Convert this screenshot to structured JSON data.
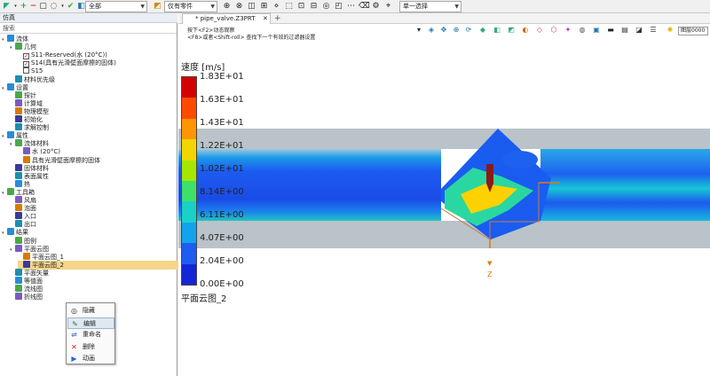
{
  "toolbar": {
    "filter_select": "全部",
    "scope_select": "仅有零件",
    "mode_select": "单一选择"
  },
  "left_panel": {
    "title": "仿真",
    "search_placeholder": "搜索",
    "tree": [
      {
        "label": "流体",
        "level": 0,
        "icon": "fluid-icon",
        "toggle": "▾"
      },
      {
        "label": "几何",
        "level": 1,
        "icon": "geometry-icon",
        "toggle": "▾"
      },
      {
        "label": "S11-Reserved(水 (20°C))",
        "level": 2,
        "checkbox": true,
        "checked": true
      },
      {
        "label": "S14(具有光滑壁面摩擦的固体)",
        "level": 2,
        "checkbox": true,
        "checked": true
      },
      {
        "label": "S15",
        "level": 2,
        "checkbox": true,
        "checked": false
      },
      {
        "label": "材料优先级",
        "level": 1,
        "icon": "material-priority-icon"
      },
      {
        "label": "设置",
        "level": 0,
        "icon": "settings-icon",
        "toggle": "▾"
      },
      {
        "label": "探针",
        "level": 1,
        "icon": "probe-icon"
      },
      {
        "label": "计算域",
        "level": 1,
        "icon": "domain-icon"
      },
      {
        "label": "物理模型",
        "level": 1,
        "icon": "physics-icon"
      },
      {
        "label": "初始化",
        "level": 1,
        "icon": "init-icon"
      },
      {
        "label": "求解控制",
        "level": 1,
        "icon": "solver-icon"
      },
      {
        "label": "属性",
        "level": 0,
        "icon": "properties-icon",
        "toggle": "▾"
      },
      {
        "label": "流体材料",
        "level": 1,
        "icon": "fluid-material-icon",
        "toggle": "▾"
      },
      {
        "label": "水 (20°C)",
        "level": 2,
        "icon": "water-icon"
      },
      {
        "label": "具有光滑壁面摩擦的固体",
        "level": 2,
        "icon": "solid-icon"
      },
      {
        "label": "固体材料",
        "level": 1,
        "icon": "solid-material-icon"
      },
      {
        "label": "表面属性",
        "level": 1,
        "icon": "surface-icon"
      },
      {
        "label": "热",
        "level": 1,
        "icon": "heat-icon"
      },
      {
        "label": "工具箱",
        "level": 0,
        "icon": "toolbox-icon",
        "toggle": "▾"
      },
      {
        "label": "风扇",
        "level": 1,
        "icon": "fan-icon"
      },
      {
        "label": "泡面",
        "level": 1,
        "icon": "foam-icon"
      },
      {
        "label": "入口",
        "level": 1,
        "icon": "inlet-icon"
      },
      {
        "label": "出口",
        "level": 1,
        "icon": "outlet-icon"
      },
      {
        "label": "结果",
        "level": 0,
        "icon": "results-icon",
        "toggle": "▾"
      },
      {
        "label": "图例",
        "level": 1,
        "icon": "legend-icon"
      },
      {
        "label": "平面云图",
        "level": 1,
        "icon": "plane-contour-icon",
        "toggle": "▾"
      },
      {
        "label": "平面云图_1",
        "level": 2,
        "icon": "contour-item-icon"
      },
      {
        "label": "平面云图_2",
        "level": 2,
        "icon": "contour-item-icon",
        "selected": true
      },
      {
        "label": "平面矢量",
        "level": 1,
        "icon": "plane-vector-icon"
      },
      {
        "label": "等值面",
        "level": 1,
        "icon": "isosurface-icon"
      },
      {
        "label": "流线图",
        "level": 1,
        "icon": "streamline-icon"
      },
      {
        "label": "折线图",
        "level": 1,
        "icon": "line-chart-icon"
      }
    ]
  },
  "context_menu": {
    "items": [
      {
        "label": "隐藏",
        "icon": "hide-icon",
        "glyph": "◎"
      },
      {
        "label": "编辑",
        "icon": "edit-icon",
        "glyph": "✎",
        "hover": true
      },
      {
        "label": "重命名",
        "icon": "rename-icon",
        "glyph": "⇌"
      },
      {
        "label": "删除",
        "icon": "delete-icon",
        "glyph": "✕"
      },
      {
        "label": "动画",
        "icon": "animate-icon",
        "glyph": "▶"
      }
    ]
  },
  "document": {
    "tab_label": "* pipe_valve.Z3PRT",
    "tab_close": "✕",
    "tab_add": "+",
    "hint_line1": "按下<F2>动态观察",
    "hint_line2": "<F8>或者<Shift-roll> 查找下一个有效的过滤器设置",
    "view_input": "图层0000"
  },
  "legend": {
    "title": "速度 [m/s]",
    "labels": [
      "1.83E+01",
      "1.63E+01",
      "1.43E+01",
      "1.22E+01",
      "1.02E+01",
      "8.14E+00",
      "6.11E+00",
      "4.07E+00",
      "2.04E+00",
      "0.00E+00"
    ],
    "colors": [
      "#d40000",
      "#ff4a00",
      "#ff9500",
      "#f3d600",
      "#a7e600",
      "#3fe06a",
      "#1ad1c8",
      "#12a3ee",
      "#1e5df0",
      "#1326d8"
    ],
    "plot_name": "平面云图_2"
  },
  "axis": {
    "z_label": "Z"
  },
  "colors": {
    "selection": "#f5d58a",
    "accent": "#e07b00"
  }
}
